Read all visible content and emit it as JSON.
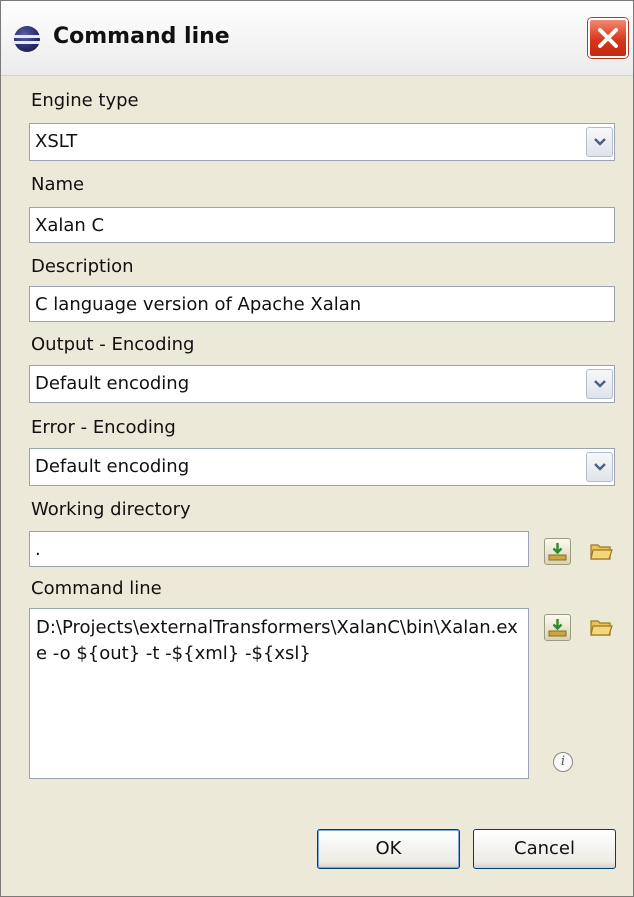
{
  "window": {
    "title": "Command line"
  },
  "form": {
    "engine_type": {
      "label": "Engine type",
      "value": "XSLT"
    },
    "name": {
      "label": "Name",
      "value": "Xalan C"
    },
    "description": {
      "label": "Description",
      "value": "C language version of Apache Xalan"
    },
    "output_encoding": {
      "label": "Output - Encoding",
      "value": "Default encoding"
    },
    "error_encoding": {
      "label": "Error - Encoding",
      "value": "Default encoding"
    },
    "working_directory": {
      "label": "Working directory",
      "value": "."
    },
    "command_line": {
      "label": "Command line",
      "value": "D:\\Projects\\externalTransformers\\XalanC\\bin\\Xalan.exe -o ${out} -t -${xml} -${xsl}"
    }
  },
  "buttons": {
    "ok": "OK",
    "cancel": "Cancel"
  },
  "icons": {
    "app": "eclipse-icon",
    "close": "close-icon",
    "insert_variable": "insert-variable-icon",
    "browse": "folder-icon",
    "info": "info-icon"
  },
  "colors": {
    "close_button": "#d9361c",
    "dialog_background": "#ece9d8",
    "field_border": "#9aa2b4"
  }
}
